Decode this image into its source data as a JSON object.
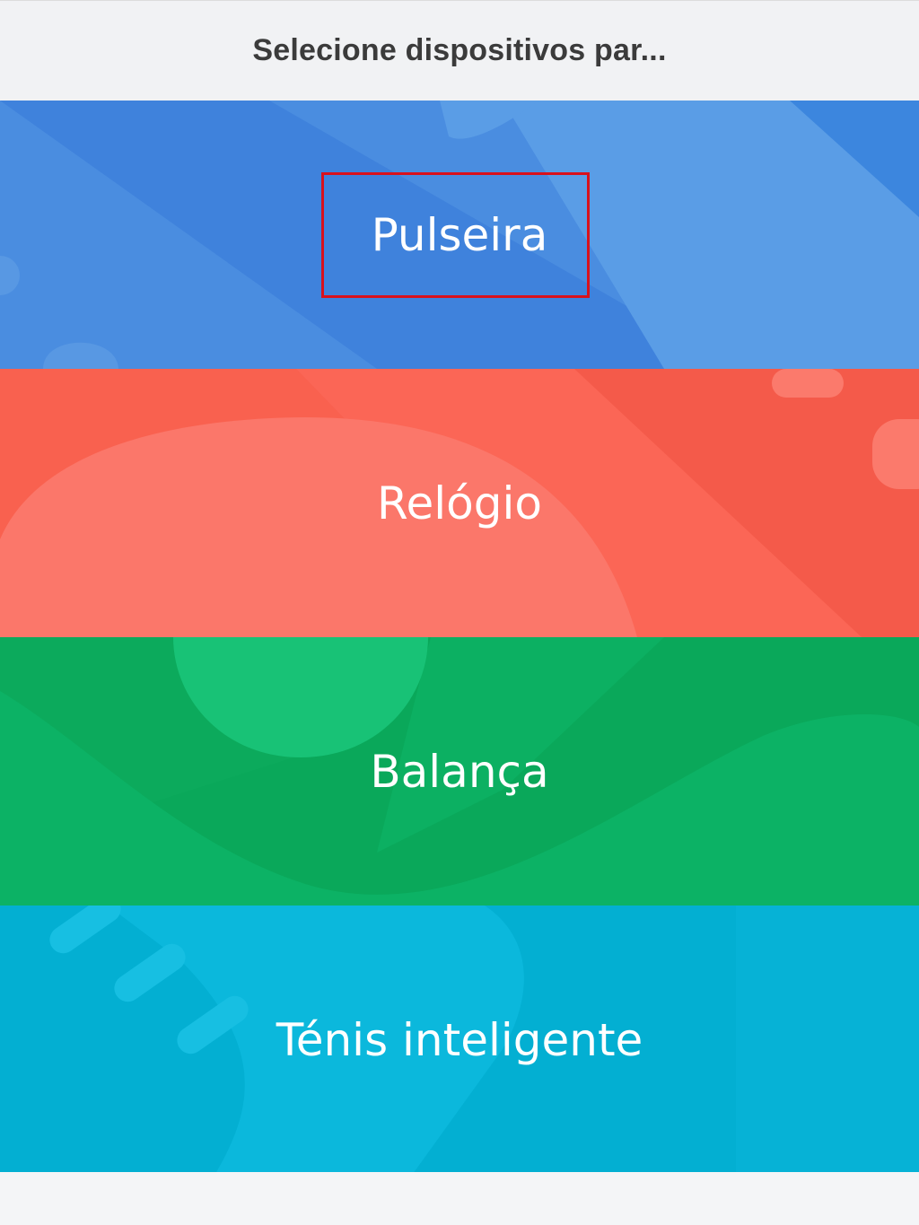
{
  "header": {
    "title": "Selecione dispositivos par..."
  },
  "devices": [
    {
      "label": "Pulseira",
      "color": "#4a8de0",
      "highlighted": true
    },
    {
      "label": "Relógio",
      "color": "#f7624f",
      "highlighted": false
    },
    {
      "label": "Balança",
      "color": "#0bb163",
      "highlighted": false
    },
    {
      "label": "Ténis inteligente",
      "color": "#06b1d4",
      "highlighted": false
    }
  ],
  "highlight_color": "#d9111c"
}
